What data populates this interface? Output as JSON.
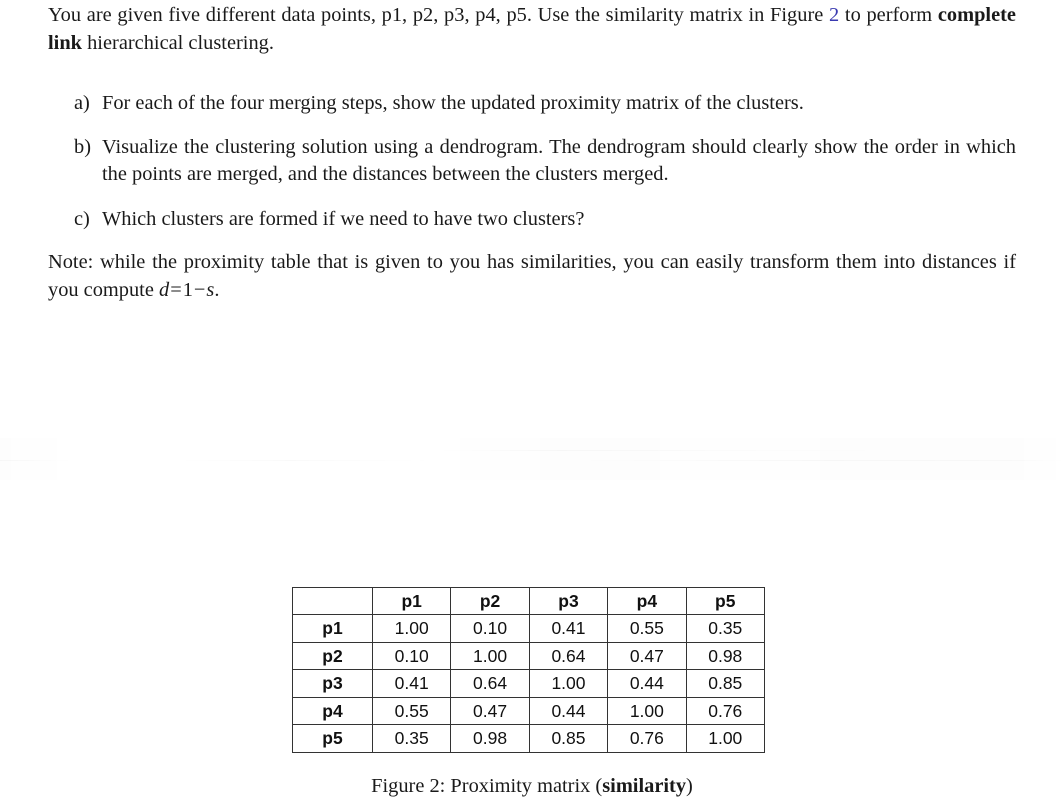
{
  "document": {
    "intro": {
      "text_before_link": "You are given five different data points, p1, p2, p3, p4, p5.  Use the similarity matrix in Figure ",
      "link_label": "2",
      "text_after_link": " to perform ",
      "bold_phrase": "complete link",
      "text_tail": " hierarchical clustering.",
      "link_color": "#3a3ab0"
    },
    "questions": [
      {
        "marker": "a)",
        "text": "For each of the four merging steps, show the updated proximity matrix of the clusters."
      },
      {
        "marker": "b)",
        "text": "Visualize the clustering solution using a dendrogram.  The dendrogram should clearly show the order in which the points are merged, and the distances between the clusters merged."
      },
      {
        "marker": "c)",
        "text": "Which clusters are formed if we need to have two clusters?"
      }
    ],
    "note": {
      "lead": "Note: while the proximity table that is given to you has similarities, you can easily transform them into distances if you compute ",
      "formula_var": "d",
      "formula_eq": "=",
      "formula_one": "1",
      "formula_minus": "−",
      "formula_s": "s",
      "formula_period": "."
    },
    "caption": {
      "prefix": "Figure 2: Proximity matrix (",
      "bold": "similarity",
      "suffix": ")"
    }
  },
  "chart_data": {
    "type": "table",
    "title": "Figure 2: Proximity matrix (similarity)",
    "corner_label": "",
    "categories": [
      "p1",
      "p2",
      "p3",
      "p4",
      "p5"
    ],
    "column_headers": [
      "p1",
      "p2",
      "p3",
      "p4",
      "p5"
    ],
    "row_headers": [
      "p1",
      "p2",
      "p3",
      "p4",
      "p5"
    ],
    "rows": [
      {
        "label": "p1",
        "values": [
          "1.00",
          "0.10",
          "0.41",
          "0.55",
          "0.35"
        ]
      },
      {
        "label": "p2",
        "values": [
          "0.10",
          "1.00",
          "0.64",
          "0.47",
          "0.98"
        ]
      },
      {
        "label": "p3",
        "values": [
          "0.41",
          "0.64",
          "1.00",
          "0.44",
          "0.85"
        ]
      },
      {
        "label": "p4",
        "values": [
          "0.55",
          "0.47",
          "0.44",
          "1.00",
          "0.76"
        ]
      },
      {
        "label": "p5",
        "values": [
          "0.35",
          "0.98",
          "0.85",
          "0.76",
          "1.00"
        ]
      }
    ],
    "matrix": [
      [
        1.0,
        0.1,
        0.41,
        0.55,
        0.35
      ],
      [
        0.1,
        1.0,
        0.64,
        0.47,
        0.98
      ],
      [
        0.41,
        0.64,
        1.0,
        0.44,
        0.85
      ],
      [
        0.55,
        0.47,
        0.44,
        1.0,
        0.76
      ],
      [
        0.35,
        0.98,
        0.85,
        0.76,
        1.0
      ]
    ],
    "xlabel": "",
    "ylabel": "",
    "grid": true,
    "legend": "none"
  }
}
